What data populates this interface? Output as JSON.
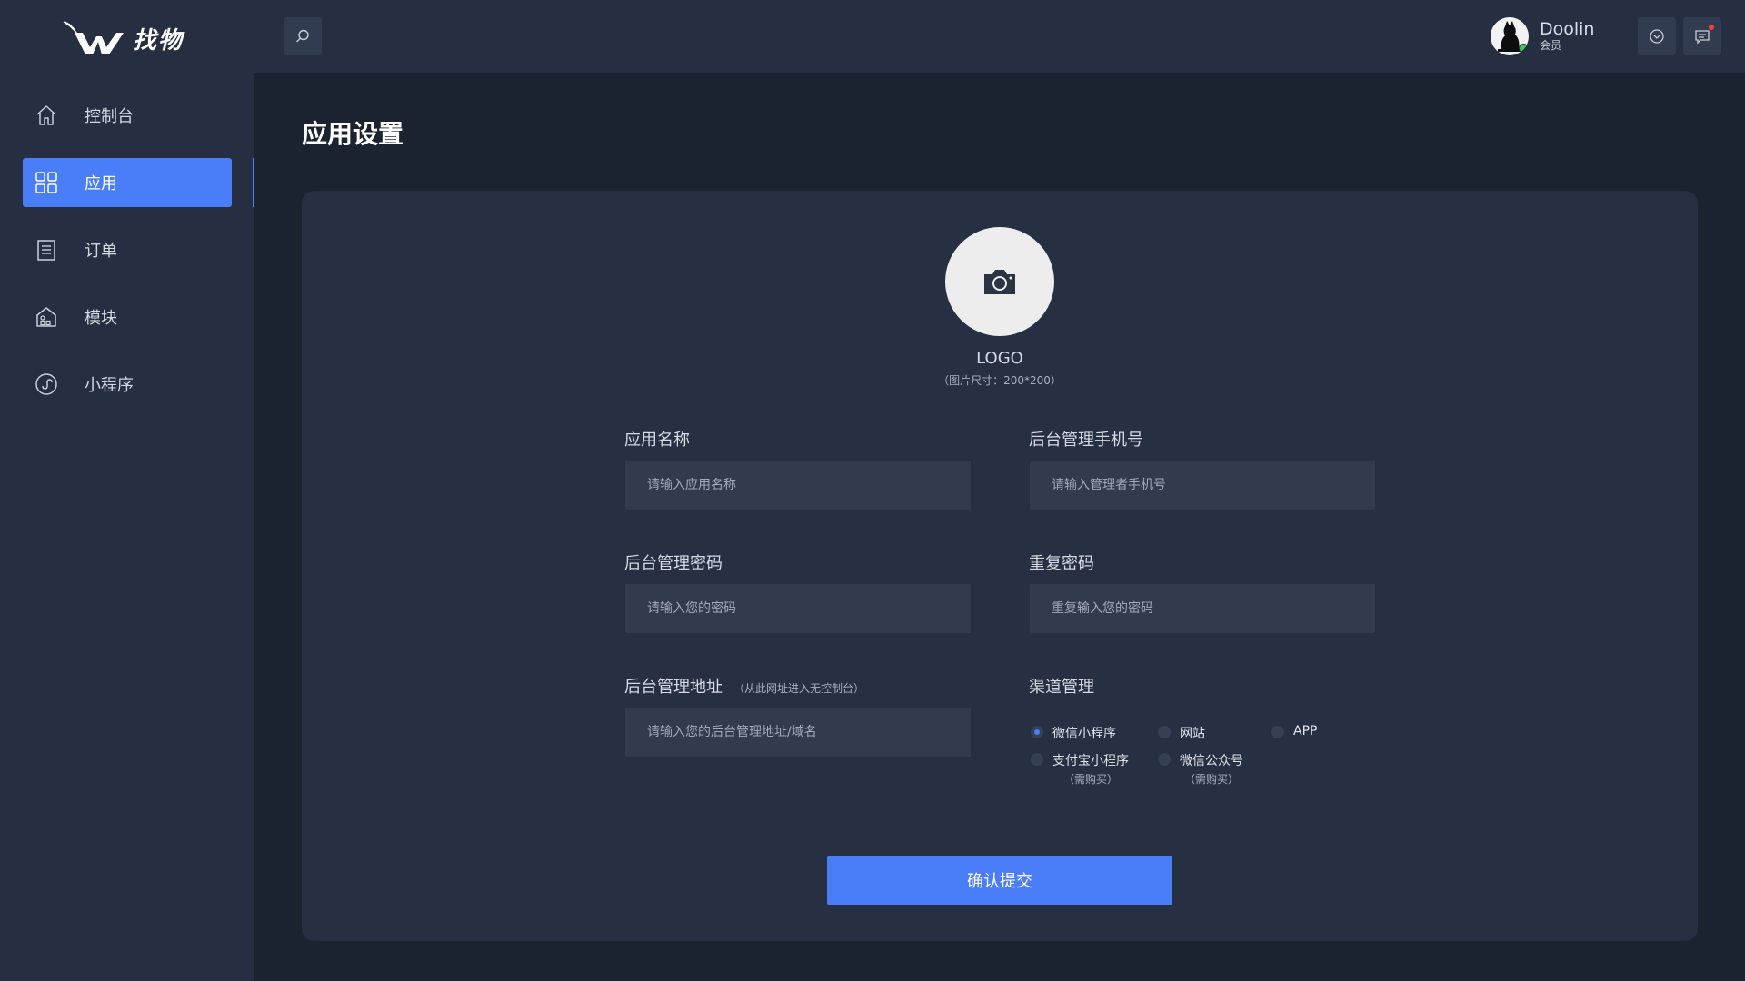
{
  "brand": {
    "logo_text": "找物"
  },
  "user": {
    "name": "Doolin",
    "role": "会员"
  },
  "sidebar": {
    "items": [
      {
        "label": "控制台",
        "icon": "home-icon"
      },
      {
        "label": "应用",
        "icon": "grid-icon",
        "active": true
      },
      {
        "label": "订单",
        "icon": "clipboard-icon"
      },
      {
        "label": "模块",
        "icon": "module-house-icon"
      },
      {
        "label": "小程序",
        "icon": "miniprogram-icon"
      }
    ]
  },
  "page": {
    "title": "应用设置"
  },
  "form": {
    "logo_label": "LOGO",
    "logo_hint": "（图片尺寸：200*200）",
    "app_name": {
      "label": "应用名称",
      "placeholder": "请输入应用名称"
    },
    "admin_phone": {
      "label": "后台管理手机号",
      "placeholder": "请输入管理者手机号"
    },
    "admin_password": {
      "label": "后台管理密码",
      "placeholder": "请输入您的密码"
    },
    "repeat_password": {
      "label": "重复密码",
      "placeholder": "重复输入您的密码"
    },
    "admin_url": {
      "label": "后台管理地址",
      "note": "（从此网址进入无控制台）",
      "placeholder": "请输入您的后台管理地址/域名"
    },
    "channels": {
      "label": "渠道管理",
      "options": [
        {
          "label": "微信小程序",
          "note": "",
          "checked": true
        },
        {
          "label": "网站",
          "note": "",
          "checked": false
        },
        {
          "label": "APP",
          "note": "",
          "checked": false
        },
        {
          "label": "支付宝小程序",
          "note": "（需购买）",
          "checked": false
        },
        {
          "label": "微信公众号",
          "note": "（需购买）",
          "checked": false
        }
      ]
    },
    "submit_label": "确认提交"
  },
  "colors": {
    "accent": "#4a7ef8",
    "bg": "#1b2230",
    "panel": "#262f41",
    "card": "#273042",
    "input": "#323b4e",
    "notification": "#ff3b3b",
    "online": "#2ed158"
  }
}
